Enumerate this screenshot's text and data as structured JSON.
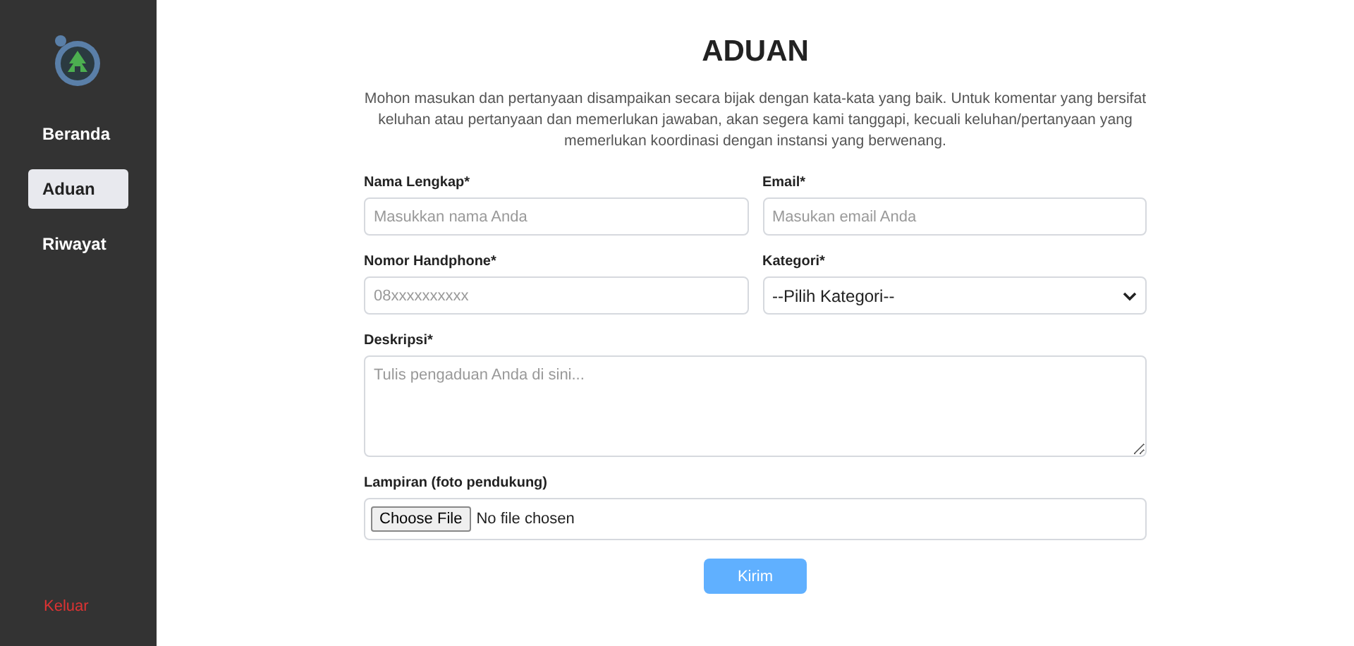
{
  "sidebar": {
    "items": [
      {
        "label": "Beranda",
        "selected": false
      },
      {
        "label": "Aduan",
        "selected": true
      },
      {
        "label": "Riwayat",
        "selected": false
      }
    ],
    "logout": "Keluar"
  },
  "page": {
    "title": "ADUAN",
    "description": "Mohon masukan dan pertanyaan disampaikan secara bijak dengan kata-kata yang baik. Untuk komentar yang bersifat keluhan atau pertanyaan dan memerlukan jawaban, akan segera kami tanggapi, kecuali keluhan/pertanyaan yang memerlukan koordinasi dengan instansi yang berwenang."
  },
  "form": {
    "rows": [
      [
        {
          "kind": "text",
          "label": "Nama Lengkap*",
          "placeholder": "Masukkan nama Anda"
        },
        {
          "kind": "text",
          "label": "Email*",
          "placeholder": "Masukan email Anda"
        }
      ],
      [
        {
          "kind": "text",
          "label": "Nomor Handphone*",
          "placeholder": "08xxxxxxxxxx"
        },
        {
          "kind": "select",
          "label": "Kategori*",
          "value": "--Pilih Kategori--"
        }
      ],
      [
        {
          "kind": "textarea",
          "label": "Deskripsi*",
          "placeholder": "Tulis pengaduan Anda di sini..."
        }
      ],
      [
        {
          "kind": "file",
          "label": "Lampiran (foto pendukung)",
          "button": "Choose File",
          "value": "No file chosen"
        }
      ]
    ],
    "submit": "Kirim"
  }
}
